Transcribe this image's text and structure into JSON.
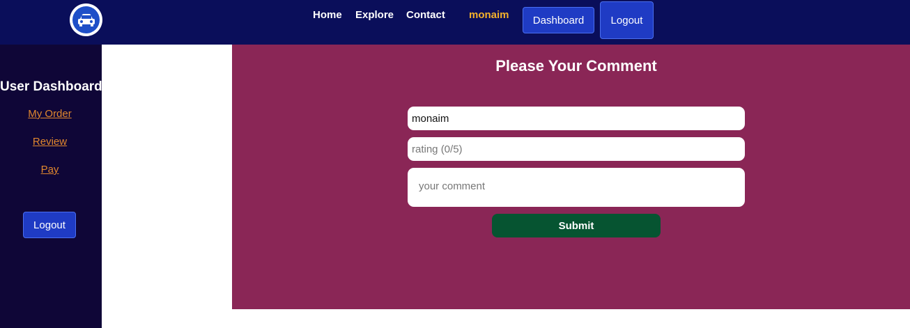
{
  "navbar": {
    "logo_icon": "car-icon",
    "links": {
      "home": "Home",
      "explore": "Explore",
      "contact": "Contact"
    },
    "username": "monaim",
    "dashboard_label": "Dashboard",
    "logout_label": "Logout"
  },
  "sidebar": {
    "title": "User Dashboard",
    "items": [
      {
        "label": "My Order"
      },
      {
        "label": "Review"
      },
      {
        "label": "Pay"
      }
    ],
    "logout_label": "Logout"
  },
  "comment_form": {
    "title": "Please Your Comment",
    "name_value": "monaim",
    "rating_placeholder": "rating (0/5)",
    "comment_placeholder": "your comment",
    "submit_label": "Submit"
  },
  "colors": {
    "navbar_bg": "#0a0e5a",
    "sidebar_bg": "#0f0637",
    "panel_bg": "#8a2656",
    "accent_link": "#e0872e",
    "username": "#f5b12b",
    "button_blue": "#1f3bc4",
    "submit_green": "#065431"
  }
}
